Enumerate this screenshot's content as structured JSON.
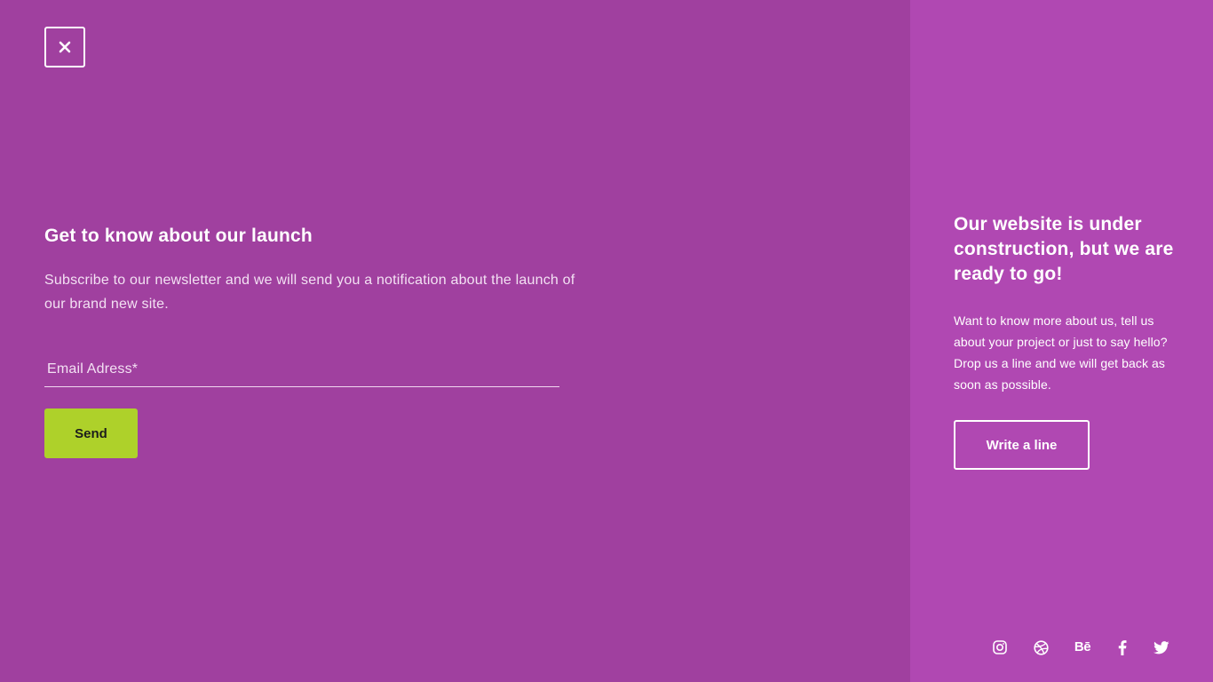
{
  "header": {
    "close_icon": "close-icon"
  },
  "subscribe": {
    "title": "Get to know about our launch",
    "description": "Subscribe to our newsletter and we will send you a notification about the launch of our brand new site.",
    "email_placeholder": "Email Adress*",
    "email_value": "",
    "send_label": "Send"
  },
  "info": {
    "title": "Our website is under construction, but we are ready to go!",
    "description": "Want to know more about us, tell us about your project or just to say hello? Drop us a line and we will get back as soon as possible.",
    "write_label": "Write a line"
  },
  "social": [
    {
      "name": "instagram-icon"
    },
    {
      "name": "dribbble-icon"
    },
    {
      "name": "behance-icon",
      "label": "Bē"
    },
    {
      "name": "facebook-icon"
    },
    {
      "name": "twitter-icon"
    }
  ],
  "colors": {
    "left_background": "#a0409f",
    "right_background": "#b048b2",
    "accent": "#aed12a",
    "text": "#ffffff"
  }
}
